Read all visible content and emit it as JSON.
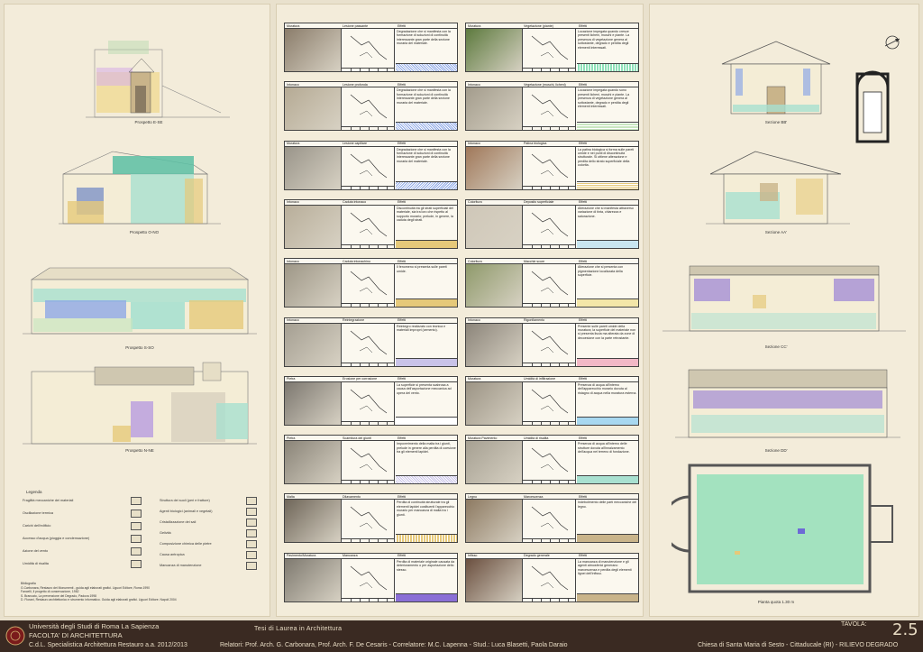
{
  "left": {
    "captions": [
      "Prospetto E-SE",
      "Prospetto O-NO",
      "Prospetto S-SO",
      "Prospetto N-NE"
    ],
    "legend_title": "Legenda",
    "legend_left": [
      "Fragilità meccaniche dei materiali",
      "Oscillazione termica",
      "Carichi dell'edificio",
      "Accesso d'acqua (pioggia e condensazione)",
      "Azione del vento",
      "Umidità di risalita"
    ],
    "legend_right": [
      "Struttura dei suoli (peri e fratture)",
      "Agenti biologici (animali e vegetali)",
      "Cristallizzazione dei sali",
      "Gelività",
      "Composizione chimica delle pietre",
      "Causa antropica",
      "Mancanza di manutenzione"
    ],
    "biblio_title": "Bibliografia",
    "biblio": [
      "G.Carbonara, Restauro dei Monumenti - guida agli elaborati grafici. Liguori Editore, Roma 1990",
      "Fancelli, Il progetto di conservazione, 1982",
      "S. Brancato, La prevenzione del Degrado, Padova 1998",
      "D. Fiorani, Restauro architettonico e strumento informatico. Guida agli elaborati grafici. Liguori Editore. Napoli 2004"
    ]
  },
  "cards": [
    {
      "material": "Muratura",
      "type": "Lesione passante",
      "effect_label": "Effetti",
      "effect": "Degradazione che si manifesta con la formazione di soluzioni di continuità interessante gran parte della sezione muraria del materiale."
    },
    {
      "material": "Muratura",
      "type": "Vegetazione (piante)",
      "effect_label": "Effetti",
      "effect": "Locazione impegata quando cresce presenti licheni, muschi e piante. La presenza di vegetazione genera al sottostante, degrado e perdita degli elementi interessati."
    },
    {
      "material": "Intonaco",
      "type": "Lesione profonda",
      "effect_label": "Effetti",
      "effect": "Degradazione che si manifesta con la formazione di soluzioni di continuità interessante gran parte della sezione muraria del materiale."
    },
    {
      "material": "Intonaco",
      "type": "Vegetazione (muschi, licheni)",
      "effect_label": "Effetti",
      "effect": "Locazione impegata quando sono presenti licheni, muschi e piante. La presenza di vegetazione genera al sottostante, degrado e perdita degli elementi interessati."
    },
    {
      "material": "Muratura",
      "type": "Lesione capillare",
      "effect_label": "Effetti",
      "effect": "Degradazione che si manifesta con la formazione di soluzioni di continuità interessante gran parte della sezione muraria del materiale."
    },
    {
      "material": "Intonaco",
      "type": "Patina biologica",
      "effect_label": "Effetti",
      "effect": "La patina biologica si forma sulle pareti umide e nei punti di discontinuità strutturale. Si ottiene alterazione e perdita dello strato superficiale della colorita."
    },
    {
      "material": "Intonaco",
      "type": "Caduta intonaco",
      "effect_label": "Effetti",
      "effect": "Discontinuità tra gli strati superficiali del materiale, sia tra loro che rispetto al supporto murario; prelude, in genere, la caduta degli strati."
    },
    {
      "material": "Coloritura",
      "type": "Deposito superficiale",
      "effect_label": "Effetti",
      "effect": "Alterazione che si manifesta attraverso variazione di tinta, chiarezza e saturazione."
    },
    {
      "material": "Intonaco",
      "type": "Caduta intonachino",
      "effect_label": "Effetti",
      "effect": "Il fenomeno si presenta sulle pareti umide."
    },
    {
      "material": "Coloritura",
      "type": "Macchie scure",
      "effect_label": "Effetti",
      "effect": "Alterazione che si presenta con pigmentazione localizzata della superficie."
    },
    {
      "material": "Intonaco",
      "type": "Reintegrazione",
      "effect_label": "Effetti",
      "effect": "Reintegro realizzato con tecnica e materiali impropri (cemento)."
    },
    {
      "material": "Intonaco",
      "type": "Rigonfiamento",
      "effect_label": "Effetti",
      "effect": "Presente sulle pareti umide della muratura; la superficie del materiale non si presenta liscia ma alterata da zone di decoesione con la parte retrostante."
    },
    {
      "material": "Pietra",
      "type": "Erosione per corrosione",
      "effect_label": "Effetti",
      "effect": "La superficie si presenta scabrosa a causa dell'asportazione meccanica ad opera del vento."
    },
    {
      "material": "Muratura",
      "type": "Umidità di infiltrazione",
      "effect_label": "Effetti",
      "effect": "Presenza di acqua all'interno dell'apparecchio murario dovuta al ristagno di acqua nella muratura esterna."
    },
    {
      "material": "Pietra",
      "type": "Scarnitura dei giunti",
      "effect_label": "Effetti",
      "effect": "Impoverimento della malta tra i giunti, prelude in genere alla perdita di coesione tra gli elementi lapidei."
    },
    {
      "material": "Muratura Pavimento",
      "type": "Umidità di risalita",
      "effect_label": "Effetti",
      "effect": "Presenza di acqua all'interno delle strutture dovuta all'innalzamento dell'acqua nel terreno di fondazione."
    },
    {
      "material": "Malta",
      "type": "Dilavamento",
      "effect_label": "Effetti",
      "effect": "Perdita di continuità strutturale tra gli elementi lapidei costituenti l'apparecchio murario per mancanza di malta tra i giunti."
    },
    {
      "material": "Legno",
      "type": "Marcescenza",
      "effect_label": "Effetti",
      "effect": "Indebolimento delle parti meccaniche del legno."
    },
    {
      "material": "Pavimento/Muratura",
      "type": "Mancanza",
      "effect_label": "Effetti",
      "effect": "Perdita di materiale originale causata da deterioramento o per asportazione dello stesso."
    },
    {
      "material": "Infisso",
      "type": "Degrado generale",
      "effect_label": "Effetti",
      "effect": "La mancanza di manutenzione e gli agenti atmosferici generano marcescenza e perdita degli elementi lignei dell'infisso."
    }
  ],
  "right": {
    "sections": [
      "Sezione BB'",
      "Sezione AA'",
      "Sezione CC'",
      "Sezione DD'"
    ],
    "plan": "Pianta quota 1.30 m"
  },
  "footer": {
    "university": "Università degli Studi di Roma La Sapienza",
    "faculty": "FACOLTA' DI ARCHITETTURA",
    "course": "C.d.L. Specialistica Architettura Restauro a.a. 2012/2013",
    "thesis": "Tesi  di Laurea  in Architettura",
    "relatori": "Relatori: Prof. Arch. G. Carbonara, Prof. Arch. F. De Cesaris - Correlatore: M.C. Lapenna - Stud.: Luca Blasetti, Paola Daraio",
    "tavola_label": "TAVOLA:",
    "tavola_number": "2.5",
    "church": "Chiesa di Santa Maria di Sesto - Cittaducale (RI) -  RILIEVO DEGRADO"
  }
}
